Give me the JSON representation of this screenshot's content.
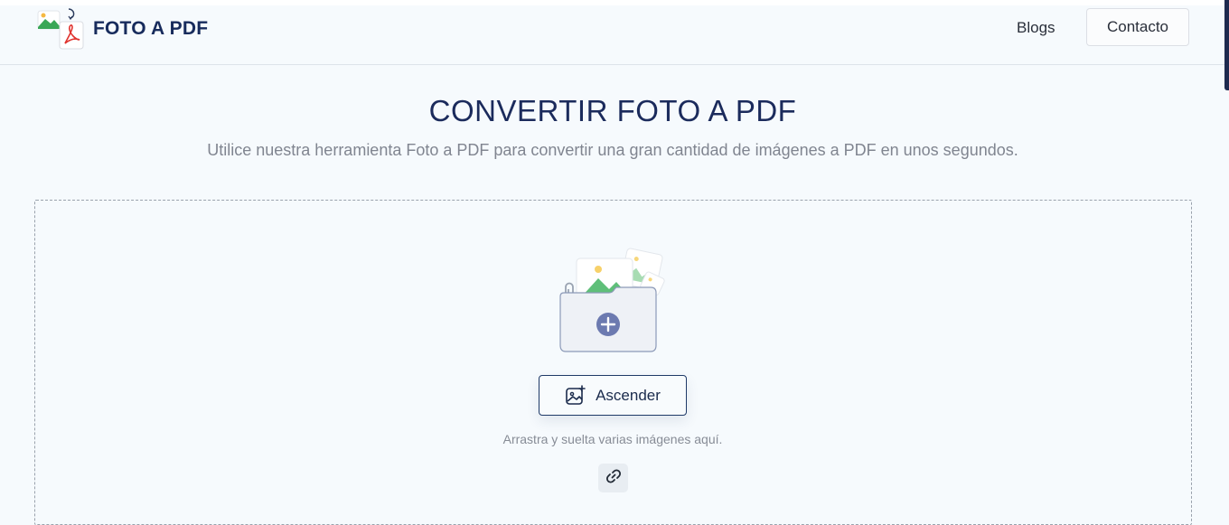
{
  "header": {
    "brand": "FOTO A PDF",
    "nav": {
      "blogs": "Blogs",
      "contact": "Contacto"
    }
  },
  "main": {
    "title": "CONVERTIR FOTO A PDF",
    "subtitle": "Utilice nuestra herramienta Foto a PDF para convertir una gran cantidad de imágenes a PDF en unos segundos.",
    "upload_label": "Ascender",
    "hint": "Arrastra y suelta varias imágenes aquí."
  },
  "icons": {
    "logo": "image-to-pdf-logo-icon",
    "upload": "image-add-icon",
    "link": "link-icon",
    "illustration": "folder-images-add-icon"
  },
  "colors": {
    "brand": "#172b5c",
    "background": "#f6fafd",
    "upload_border": "#1f3a68"
  }
}
